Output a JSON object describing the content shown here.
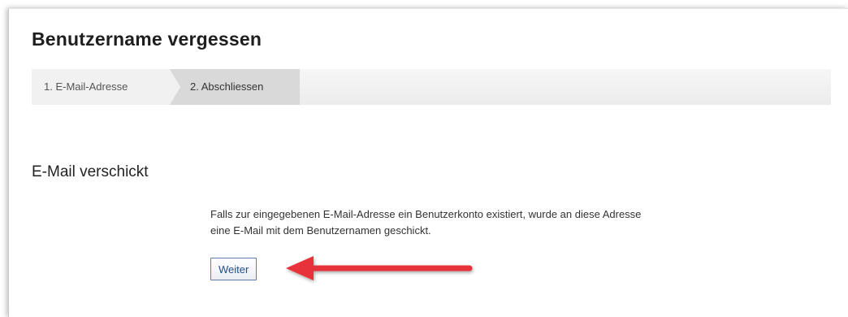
{
  "page": {
    "title": "Benutzername vergessen"
  },
  "steps": [
    {
      "label": "1. E-Mail-Adresse",
      "active": false
    },
    {
      "label": "2. Abschliessen",
      "active": true
    }
  ],
  "confirmation": {
    "heading": "E-Mail verschickt",
    "message_line1": "Falls zur eingegebenen E-Mail-Adresse ein Benutzerkonto existiert, wurde an diese Adresse",
    "message_line2": "eine E-Mail mit dem Benutzernamen geschickt.",
    "button_label": "Weiter"
  },
  "annotation": {
    "icon": "red-arrow-icon",
    "color": "#e8323a"
  }
}
